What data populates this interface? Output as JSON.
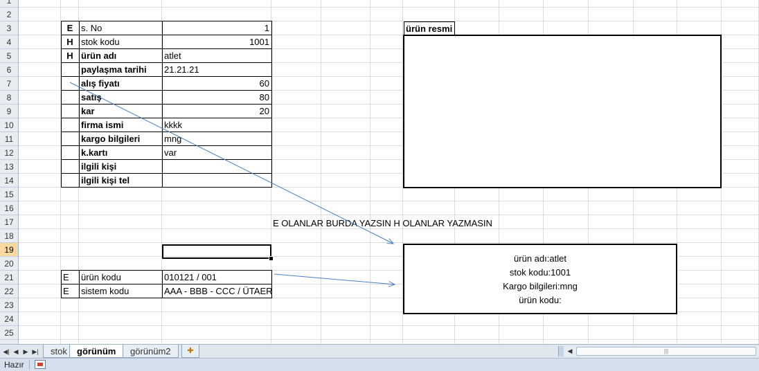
{
  "rows": [
    "1",
    "2",
    "3",
    "4",
    "5",
    "6",
    "7",
    "8",
    "9",
    "10",
    "11",
    "12",
    "13",
    "14",
    "15",
    "16",
    "17",
    "18",
    "19",
    "20",
    "21",
    "22",
    "23",
    "24",
    "25"
  ],
  "selected_row": "19",
  "form": [
    {
      "flag": "E",
      "label": "s. No",
      "value": "1",
      "bold": false,
      "align": "right"
    },
    {
      "flag": "H",
      "label": "stok kodu",
      "value": "1001",
      "bold": false,
      "align": "right"
    },
    {
      "flag": "H",
      "label": "ürün adı",
      "value": "atlet",
      "bold": true,
      "align": "left"
    },
    {
      "flag": "",
      "label": "paylaşma tarihi",
      "value": "21.21.21",
      "bold": true,
      "align": "left"
    },
    {
      "flag": "",
      "label": "alış fiyatı",
      "value": "60",
      "bold": true,
      "align": "right"
    },
    {
      "flag": "",
      "label": "satış",
      "value": "80",
      "bold": true,
      "align": "right"
    },
    {
      "flag": "",
      "label": "kar",
      "value": "20",
      "bold": true,
      "align": "right"
    },
    {
      "flag": "",
      "label": "firma ismi",
      "value": "kkkk",
      "bold": true,
      "align": "left"
    },
    {
      "flag": "",
      "label": "kargo bilgileri",
      "value": "mng",
      "bold": true,
      "align": "left"
    },
    {
      "flag": "",
      "label": "k.kartı",
      "value": "var",
      "bold": true,
      "align": "left"
    },
    {
      "flag": "",
      "label": "ilgili kişi",
      "value": "",
      "bold": true,
      "align": "left"
    },
    {
      "flag": "",
      "label": "ilgili kişi tel",
      "value": "",
      "bold": true,
      "align": "left"
    }
  ],
  "codes": [
    {
      "flag": "E",
      "label": "ürün kodu",
      "value": "010121 / 001"
    },
    {
      "flag": "E",
      "label": "sistem kodu",
      "value": "AAA - BBB - CCC / ÜTAER"
    }
  ],
  "image_box_title": "ürün resmi",
  "note": "E OLANLAR BURDA YAZSIN H OLANLAR YAZMASIN",
  "info_box": [
    "ürün adı:atlet",
    "stok kodu:1001",
    "Kargo bilgileri:mng",
    "ürün kodu:"
  ],
  "sheet_tabs": [
    {
      "label": "stok",
      "active": false
    },
    {
      "label": "görünüm",
      "active": true
    },
    {
      "label": "görünüm2",
      "active": false
    }
  ],
  "status": "Hazır",
  "icons": {
    "nav_first": "first-sheet-icon",
    "nav_prev": "prev-sheet-icon",
    "nav_next": "next-sheet-icon",
    "nav_last": "last-sheet-icon",
    "new_sheet": "insert-sheet-icon",
    "macro": "record-macro-icon"
  }
}
